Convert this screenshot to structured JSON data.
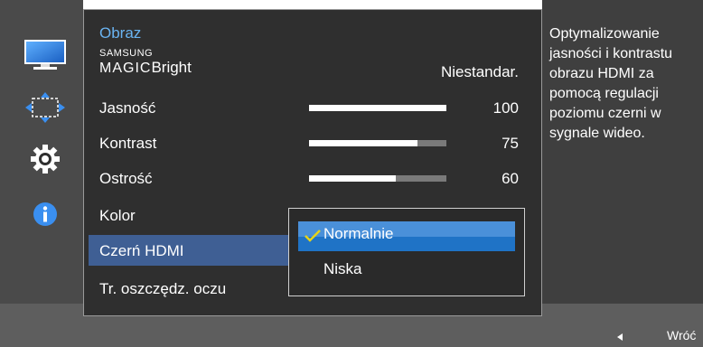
{
  "sidebar": {
    "items": [
      {
        "icon": "monitor-icon"
      },
      {
        "icon": "move-arrows-icon"
      },
      {
        "icon": "gear-icon"
      },
      {
        "icon": "info-icon"
      }
    ]
  },
  "menu": {
    "title": "Obraz",
    "magic_bright": {
      "brand_top": "SAMSUNG",
      "brand_main": "MAGIC",
      "label": "Bright",
      "value": "Niestandar."
    },
    "brightness": {
      "label": "Jasność",
      "value": "100",
      "level": 1.0
    },
    "contrast": {
      "label": "Kontrast",
      "value": "75",
      "level": 0.75
    },
    "sharpness": {
      "label": "Ostrość",
      "value": "60",
      "level": 0.6
    },
    "color": {
      "label": "Kolor"
    },
    "hdmi_black": {
      "label": "Czerń HDMI"
    },
    "eye_saver": {
      "label": "Tr. oszczędz. oczu"
    }
  },
  "dropdown": {
    "options": [
      {
        "label": "Normalnie",
        "selected": true
      },
      {
        "label": "Niska",
        "selected": false
      }
    ]
  },
  "description": "Optymalizowanie jasności i kontrastu obrazu HDMI za pomocą regulacji poziomu czerni w sygnale wideo.",
  "footer": {
    "back_label": "Wróć"
  },
  "colors": {
    "accent": "#1f73c6",
    "title": "#6ab4f2",
    "check": "#e6d419"
  }
}
